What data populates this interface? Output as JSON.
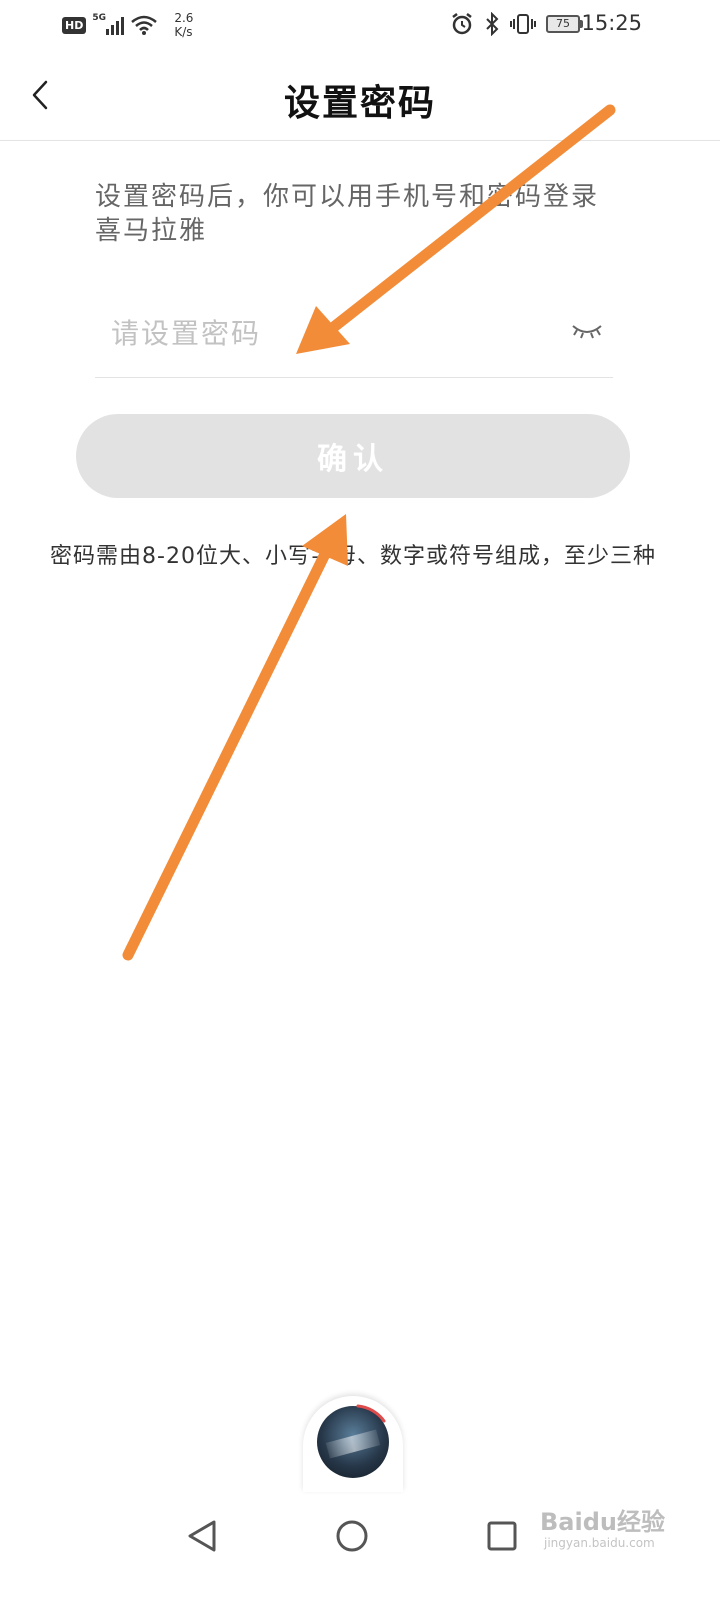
{
  "status_bar": {
    "hd_label": "HD",
    "network_label": "5G",
    "speed_value": "2.6",
    "speed_unit": "K/s",
    "battery_level": "75",
    "time": "15:25",
    "icons": [
      "alarm-icon",
      "bluetooth-icon",
      "vibrate-icon",
      "wifi-icon",
      "signal-icon",
      "battery-icon"
    ]
  },
  "header": {
    "back_icon": "chevron-left-icon",
    "title": "设置密码"
  },
  "description": {
    "line1": "设置密码后，你可以用手机号和密码登录",
    "line2": "喜马拉雅"
  },
  "password_field": {
    "value": "",
    "placeholder": "请设置密码",
    "toggle_icon": "eye-closed-icon"
  },
  "confirm_button": {
    "label": "确认",
    "enabled": false
  },
  "hint": "密码需由8-20位大、小写字母、数字或符号组成，至少三种",
  "mini_player": {
    "cover_icon": "album-cover"
  },
  "nav_bar": {
    "back_icon": "triangle-back-icon",
    "home_icon": "circle-home-icon",
    "recents_icon": "square-recents-icon"
  },
  "watermark": {
    "text": "Baidu经验",
    "url": "jingyan.baidu.com"
  },
  "annotation_color": "#f28c38"
}
